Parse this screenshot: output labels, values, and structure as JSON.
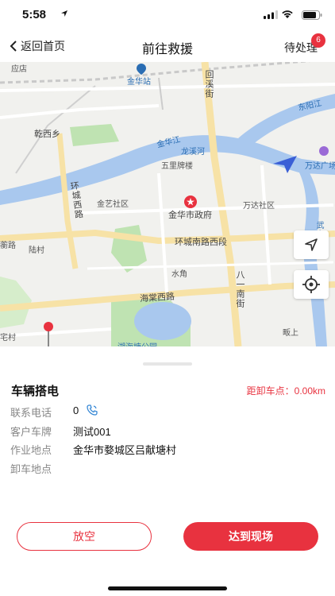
{
  "status_bar": {
    "time": "5:58"
  },
  "nav": {
    "back_label": "返回首页",
    "title": "前往救援",
    "pending_label": "待处理",
    "pending_count": "6"
  },
  "map": {
    "labels": {
      "yingsuo": "应店",
      "jinhua_station": "金华站",
      "huixi_street": "回溪街",
      "dongyang_river": "东阳江",
      "qianxi_township": "乾西乡",
      "jinhua_river": "金华江",
      "longqi_river": "龙溪河",
      "wanda_plaza": "万达广场",
      "wulipai_lou": "五里牌楼",
      "huancheng_west_road": "环城西路",
      "jinyi_community": "金艺社区",
      "wanda_community": "万达社区",
      "city_government": "金华市政府",
      "wuyi_river": "武义江",
      "huancheng_south_west_road": "环城南路西段",
      "weidu_road": "蘅路",
      "lu_village": "陆村",
      "shuijiao": "水角",
      "bayi_south_street": "八一南街",
      "haitang_west_road": "海棠西路",
      "fanshang": "畈上",
      "zhai_cun": "宅村",
      "huhai_park": "湖海塘公园"
    }
  },
  "task": {
    "title": "车辆搭电",
    "distance": "距卸车点：0.00km",
    "fields": [
      {
        "label": "联系电话",
        "value": "0"
      },
      {
        "label": "客户车牌",
        "value": "测试001"
      },
      {
        "label": "作业地点",
        "value": "金华市婺城区吕献塘村"
      },
      {
        "label": "卸车地点",
        "value": ""
      }
    ]
  },
  "buttons": {
    "empty": "放空",
    "arrive": "达到现场"
  },
  "colors": {
    "accent": "#e8323f",
    "river": "#a9c8ee",
    "park": "#bfe3b2",
    "nav_arrow": "#3a5fd6"
  }
}
